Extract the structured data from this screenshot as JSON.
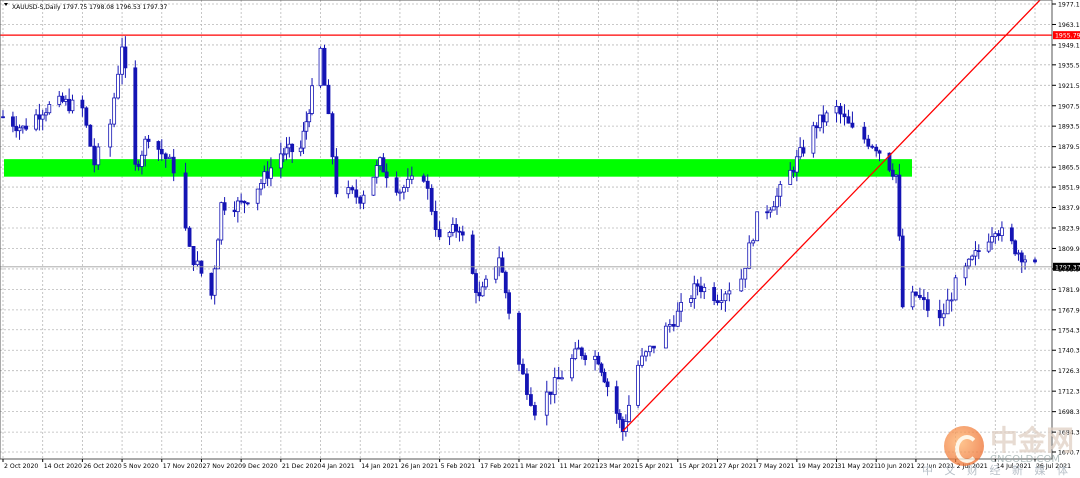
{
  "header": {
    "symbol_line": "XAUUSD-S,Daily  1797.75 1798.08 1796.53 1797.37"
  },
  "watermark": {
    "brand": "中金网",
    "url": "CNGOLD.COM",
    "slogan": "中 文 财 经 新 媒 体"
  },
  "colors": {
    "background": "#ffffff",
    "grid": "#b8b8b8",
    "candle": "#1414b4",
    "resistance_line": "#ff0000",
    "trend_line": "#ff0000",
    "zone": "#00ff00",
    "current_price_line": "#a0a0a0"
  },
  "chart_data": {
    "type": "candlestick",
    "title": "XAUUSD-S,Daily",
    "y_ticks": [
      "1977.10",
      "1963.10",
      "1949.10",
      "1935.50",
      "1921.50",
      "1907.50",
      "1893.55",
      "1879.55",
      "1865.50",
      "1851.90",
      "1837.90",
      "1823.90",
      "1809.90",
      "1795.90",
      "1781.90",
      "1767.90",
      "1754.30",
      "1740.30",
      "1726.30",
      "1712.30",
      "1698.30",
      "1684.30",
      "1670.70"
    ],
    "ylim": [
      1670.7,
      1977.1
    ],
    "x_ticks": [
      "2 Oct 2020",
      "14 Oct 2020",
      "26 Oct 2020",
      "5 Nov 2020",
      "17 Nov 2020",
      "27 Nov 2020",
      "9 Dec 2020",
      "21 Dec 2020",
      "4 Jan 2021",
      "14 Jan 2021",
      "26 Jan 2021",
      "5 Feb 2021",
      "17 Feb 2021",
      "1 Mar 2021",
      "11 Mar 2021",
      "23 Mar 2021",
      "5 Apr 2021",
      "15 Apr 2021",
      "27 Apr 2021",
      "7 May 2021",
      "19 May 2021",
      "31 May 2021",
      "10 Jun 2021",
      "22 Jun 2021",
      "2 Jul 2021",
      "14 Jul 2021",
      "26 Jul 2021"
    ],
    "resistance_level": 1955.79,
    "resistance_label": "1955.79",
    "current_price": 1797.37,
    "current_label": "1797.37",
    "zone": {
      "low": 1859.0,
      "high": 1871.0
    },
    "trendline": {
      "start_bar": 0,
      "start_price": 1685.0,
      "end_price": 1980.0
    },
    "close_path": [
      {
        "x": "2 Oct 2020",
        "c": 1900
      },
      {
        "x": "8 Oct 2020",
        "c": 1892
      },
      {
        "x": "14 Oct 2020",
        "c": 1905
      },
      {
        "x": "20 Oct 2020",
        "c": 1910
      },
      {
        "x": "26 Oct 2020",
        "c": 1905
      },
      {
        "x": "29 Oct 2020",
        "c": 1868
      },
      {
        "x": "2 Nov 2020",
        "c": 1895
      },
      {
        "x": "5 Nov 2020",
        "c": 1950
      },
      {
        "x": "9 Nov 2020",
        "c": 1865
      },
      {
        "x": "13 Nov 2020",
        "c": 1888
      },
      {
        "x": "17 Nov 2020",
        "c": 1875
      },
      {
        "x": "20 Nov 2020",
        "c": 1865
      },
      {
        "x": "24 Nov 2020",
        "c": 1808
      },
      {
        "x": "30 Nov 2020",
        "c": 1778
      },
      {
        "x": "3 Dec 2020",
        "c": 1840
      },
      {
        "x": "9 Dec 2020",
        "c": 1840
      },
      {
        "x": "15 Dec 2020",
        "c": 1855
      },
      {
        "x": "21 Dec 2020",
        "c": 1875
      },
      {
        "x": "28 Dec 2020",
        "c": 1878
      },
      {
        "x": "4 Jan 2021",
        "c": 1945
      },
      {
        "x": "8 Jan 2021",
        "c": 1850
      },
      {
        "x": "14 Jan 2021",
        "c": 1845
      },
      {
        "x": "20 Jan 2021",
        "c": 1868
      },
      {
        "x": "26 Jan 2021",
        "c": 1850
      },
      {
        "x": "1 Feb 2021",
        "c": 1860
      },
      {
        "x": "5 Feb 2021",
        "c": 1815
      },
      {
        "x": "11 Feb 2021",
        "c": 1825
      },
      {
        "x": "17 Feb 2021",
        "c": 1775
      },
      {
        "x": "23 Feb 2021",
        "c": 1805
      },
      {
        "x": "1 Mar 2021",
        "c": 1730
      },
      {
        "x": "5 Mar 2021",
        "c": 1700
      },
      {
        "x": "11 Mar 2021",
        "c": 1720
      },
      {
        "x": "17 Mar 2021",
        "c": 1740
      },
      {
        "x": "23 Mar 2021",
        "c": 1735
      },
      {
        "x": "31 Mar 2021",
        "c": 1685
      },
      {
        "x": "5 Apr 2021",
        "c": 1730
      },
      {
        "x": "15 Apr 2021",
        "c": 1765
      },
      {
        "x": "21 Apr 2021",
        "c": 1785
      },
      {
        "x": "27 Apr 2021",
        "c": 1777
      },
      {
        "x": "3 May 2021",
        "c": 1790
      },
      {
        "x": "7 May 2021",
        "c": 1830
      },
      {
        "x": "13 May 2021",
        "c": 1845
      },
      {
        "x": "19 May 2021",
        "c": 1870
      },
      {
        "x": "25 May 2021",
        "c": 1895
      },
      {
        "x": "31 May 2021",
        "c": 1905
      },
      {
        "x": "4 Jun 2021",
        "c": 1890
      },
      {
        "x": "10 Jun 2021",
        "c": 1880
      },
      {
        "x": "16 Jun 2021",
        "c": 1860
      },
      {
        "x": "18 Jun 2021",
        "c": 1770
      },
      {
        "x": "22 Jun 2021",
        "c": 1778
      },
      {
        "x": "28 Jun 2021",
        "c": 1760
      },
      {
        "x": "2 Jul 2021",
        "c": 1785
      },
      {
        "x": "8 Jul 2021",
        "c": 1805
      },
      {
        "x": "14 Jul 2021",
        "c": 1825
      },
      {
        "x": "20 Jul 2021",
        "c": 1810
      },
      {
        "x": "26 Jul 2021",
        "c": 1797
      }
    ]
  }
}
